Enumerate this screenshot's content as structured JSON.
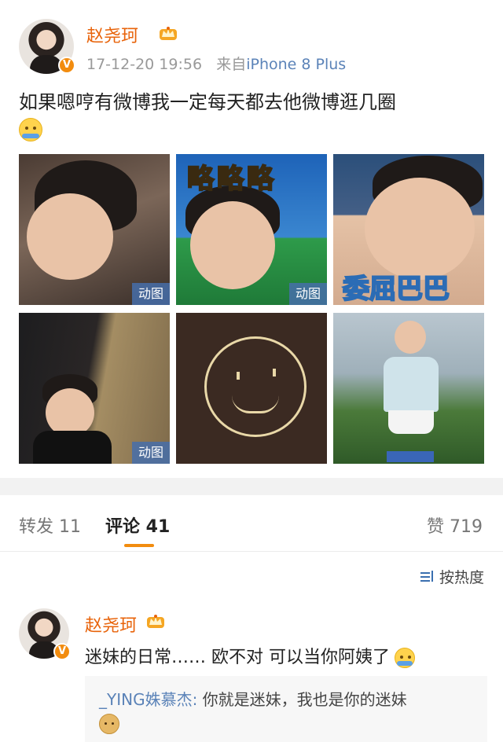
{
  "post": {
    "author": "赵尧珂",
    "timestamp": "17-12-20 19:56",
    "source_prefix": "来自",
    "source": "iPhone 8 Plus",
    "text": "如果嗯哼有微博我一定每天都去他微博逛几圈",
    "text_emoji": "hug-emoji-icon",
    "images": [
      {
        "tag": "动图",
        "overlay_text": ""
      },
      {
        "tag": "动图",
        "overlay_text": "略略略"
      },
      {
        "tag": "",
        "overlay_text": "委屈巴巴"
      },
      {
        "tag": "动图",
        "overlay_text": ""
      },
      {
        "tag": "",
        "overlay_text": ""
      },
      {
        "tag": "",
        "overlay_text": ""
      }
    ]
  },
  "tabs": {
    "repost": "转发 11",
    "comment": "评论 41",
    "like": "赞 719"
  },
  "sort": {
    "label": "按热度",
    "icon": "sort-icon"
  },
  "comment": {
    "author": "赵尧珂",
    "text": "迷妹的日常…… 欧不对 可以当你阿姨了",
    "emoji": "hug-emoji-icon",
    "reply": {
      "user": "_YING姝慕杰:",
      "text": " 你就是迷妹，我也是你的迷妹",
      "emoji": "doge-emoji-icon"
    }
  },
  "colors": {
    "username": "#e8630a",
    "link": "#5b83b8",
    "accent": "#f28c0f",
    "meta": "#999999"
  }
}
